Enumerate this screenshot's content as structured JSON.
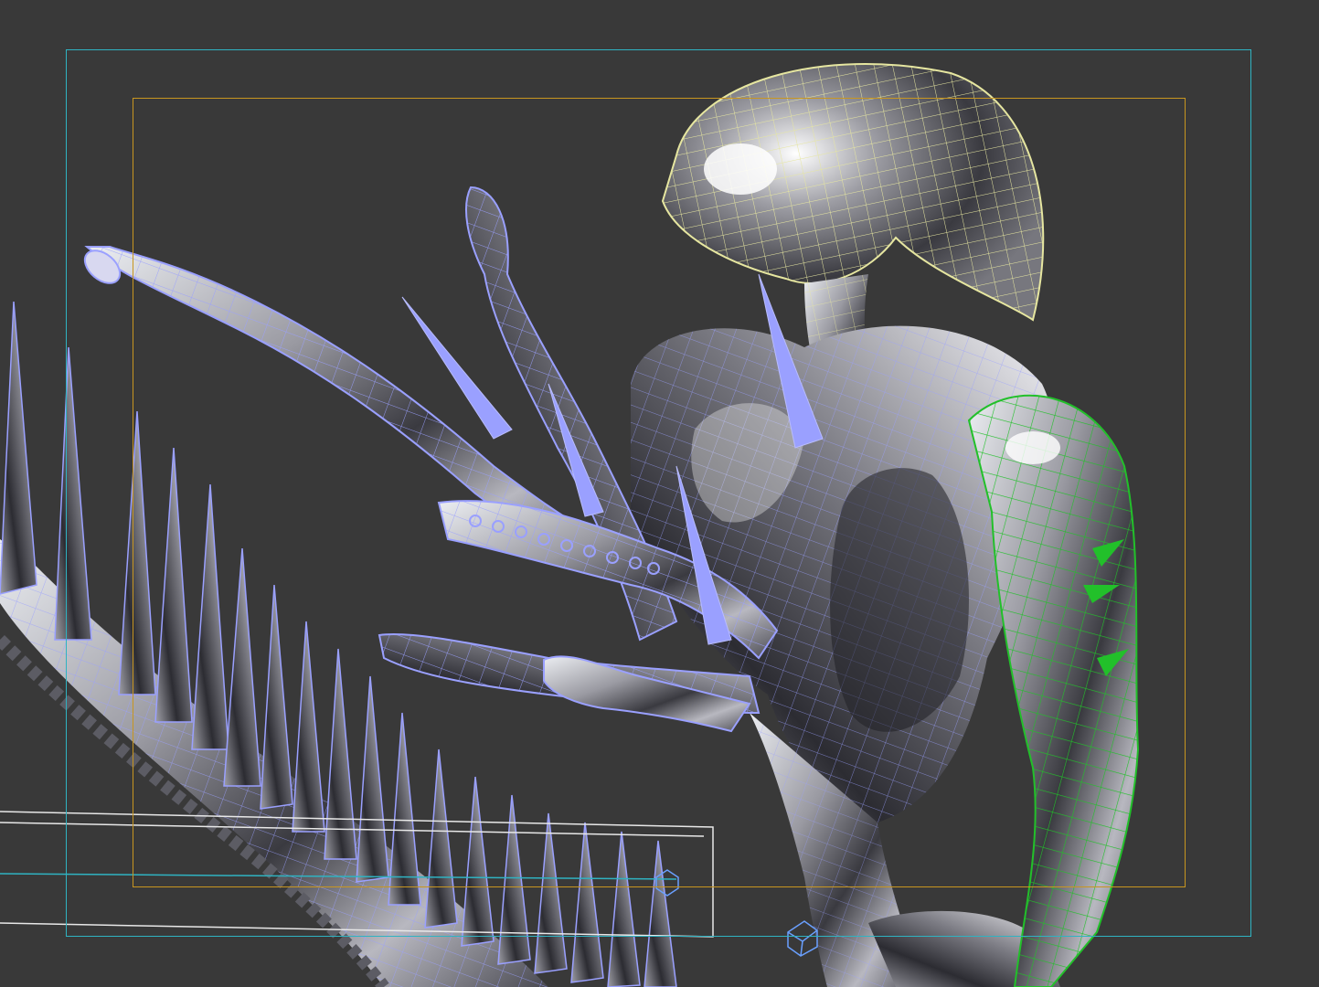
{
  "viewport": {
    "background": "#393939",
    "safe_frame_color": "#2fb3c2",
    "render_frame_color": "#c89620",
    "wire_selected_color": "#e6e6a0",
    "wire_subobject_color": "#9aa0ff",
    "wire_green_color": "#22c02a",
    "surface_dark": "#2a2a2e",
    "surface_mid": "#8c8c94",
    "surface_light": "#f2f2f5"
  }
}
